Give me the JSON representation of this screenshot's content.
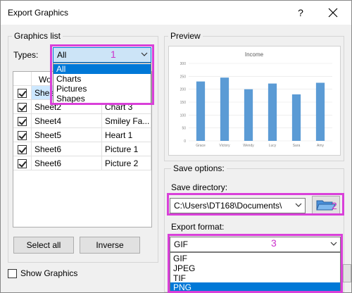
{
  "window": {
    "title": "Export Graphics",
    "help_glyph": "?",
    "close_glyph": "✕"
  },
  "graphics_list": {
    "group_label": "Graphics list",
    "types_label": "Types:",
    "types_value": "All",
    "types_options": [
      "All",
      "Charts",
      "Pictures",
      "Shapes"
    ],
    "table": {
      "header_partial": "Wo",
      "rows": [
        {
          "sheet": "Shee",
          "name": ""
        },
        {
          "sheet": "Sheet2",
          "name": "Chart 3"
        },
        {
          "sheet": "Sheet4",
          "name": "Smiley Fa..."
        },
        {
          "sheet": "Sheet5",
          "name": "Heart 1"
        },
        {
          "sheet": "Sheet6",
          "name": "Picture 1"
        },
        {
          "sheet": "Sheet6",
          "name": "Picture 2"
        }
      ]
    },
    "select_all_label": "Select all",
    "inverse_label": "Inverse"
  },
  "show_graphics_label": "Show Graphics",
  "preview": {
    "group_label": "Preview",
    "chart_data": {
      "type": "bar",
      "title": "Income",
      "categories": [
        "Grace",
        "Victory",
        "Wendy",
        "Lucy",
        "Sara",
        "Amy"
      ],
      "values": [
        230,
        245,
        200,
        222,
        180,
        225
      ],
      "ylim": [
        0,
        300
      ],
      "yticks": [
        0,
        50,
        100,
        150,
        200,
        250,
        300
      ],
      "grid": true,
      "bar_color": "#5b9bd5"
    }
  },
  "save_options": {
    "label": "Save options:",
    "directory_label": "Save directory:",
    "directory_value": "C:\\Users\\DT168\\Documents\\",
    "export_format_label": "Export format:",
    "format_value": "GIF",
    "format_options": [
      "GIF",
      "JPEG",
      "TIF",
      "PNG"
    ]
  },
  "annotations": {
    "badge1": "1",
    "badge2": "2",
    "badge3": "3"
  },
  "colors": {
    "highlight": "#d940d9",
    "selection": "#0078d7",
    "bar": "#5b9bd5"
  }
}
